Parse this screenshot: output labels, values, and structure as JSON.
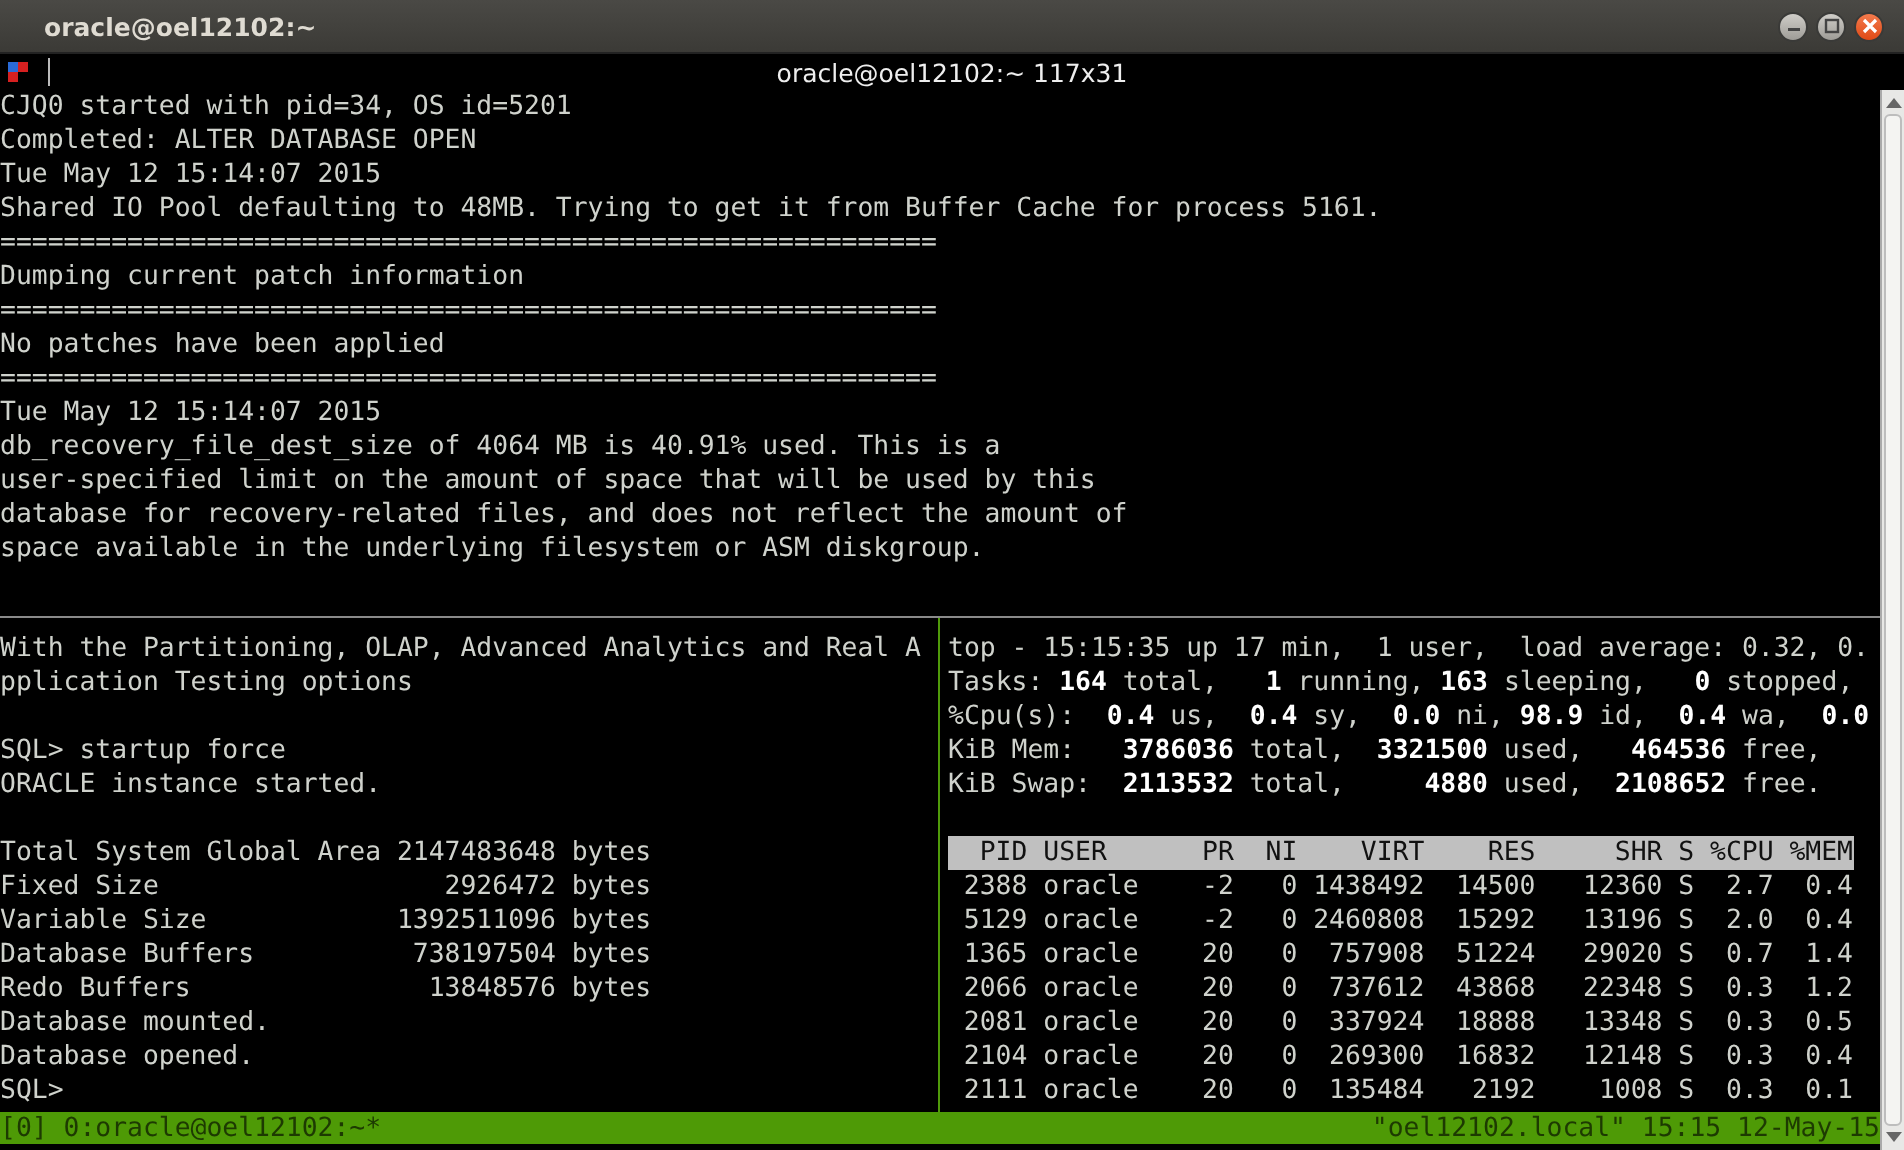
{
  "window": {
    "title": "oracle@oel12102:~"
  },
  "tab": {
    "title": "oracle@oel12102:~ 117x31"
  },
  "top_pane": {
    "lines": [
      "CJQ0 started with pid=34, OS id=5201",
      "Completed: ALTER DATABASE OPEN",
      "Tue May 12 15:14:07 2015",
      "Shared IO Pool defaulting to 48MB. Trying to get it from Buffer Cache for process 5161.",
      "===========================================================",
      "Dumping current patch information",
      "===========================================================",
      "No patches have been applied",
      "===========================================================",
      "Tue May 12 15:14:07 2015",
      "db_recovery_file_dest_size of 4064 MB is 40.91% used. This is a",
      "user-specified limit on the amount of space that will be used by this",
      "database for recovery-related files, and does not reflect the amount of",
      "space available in the underlying filesystem or ASM diskgroup."
    ]
  },
  "left_pane": {
    "blocks": [
      [
        "With the Partitioning, OLAP, Advanced Analytics and Real A",
        "pplication Testing options"
      ],
      [
        "SQL> startup force",
        "ORACLE instance started."
      ],
      [
        "Total System Global Area 2147483648 bytes",
        "Fixed Size                  2926472 bytes",
        "Variable Size            1392511096 bytes",
        "Database Buffers          738197504 bytes",
        "Redo Buffers               13848576 bytes",
        "Database mounted.",
        "Database opened.",
        "SQL>"
      ]
    ]
  },
  "right_pane": {
    "summary": [
      "top - 15:15:35 up 17 min,  1 user,  load average: 0.32, 0.",
      "Tasks: **164** total,   **1** running, **163** sleeping,   **0** stopped,",
      "%Cpu(s):  **0.4** us,  **0.4** sy,  **0.0** ni, **98.9** id,  **0.4** wa,  **0.0**",
      "KiB Mem:   **3786036** total,  **3321500** used,   **464536** free,",
      "KiB Swap:  **2113532** total,     **4880** used,  **2108652** free."
    ],
    "table": {
      "columns": [
        "PID",
        "USER",
        "PR",
        "NI",
        "VIRT",
        "RES",
        "SHR",
        "S",
        "%CPU",
        "%MEM"
      ],
      "rows": [
        [
          "2388",
          "oracle",
          "-2",
          "0",
          "1438492",
          "14500",
          "12360",
          "S",
          "2.7",
          "0.4"
        ],
        [
          "5129",
          "oracle",
          "-2",
          "0",
          "2460808",
          "15292",
          "13196",
          "S",
          "2.0",
          "0.4"
        ],
        [
          "1365",
          "oracle",
          "20",
          "0",
          "757908",
          "51224",
          "29020",
          "S",
          "0.7",
          "1.4"
        ],
        [
          "2066",
          "oracle",
          "20",
          "0",
          "737612",
          "43868",
          "22348",
          "S",
          "0.3",
          "1.2"
        ],
        [
          "2081",
          "oracle",
          "20",
          "0",
          "337924",
          "18888",
          "13348",
          "S",
          "0.3",
          "0.5"
        ],
        [
          "2104",
          "oracle",
          "20",
          "0",
          "269300",
          "16832",
          "12148",
          "S",
          "0.3",
          "0.4"
        ],
        [
          "2111",
          "oracle",
          "20",
          "0",
          "135484",
          "2192",
          "1008",
          "S",
          "0.3",
          "0.1"
        ]
      ]
    }
  },
  "status_bar": {
    "left": "[0] 0:oracle@oel12102:~*",
    "right": "\"oel12102.local\" 15:15 12-May-15"
  }
}
